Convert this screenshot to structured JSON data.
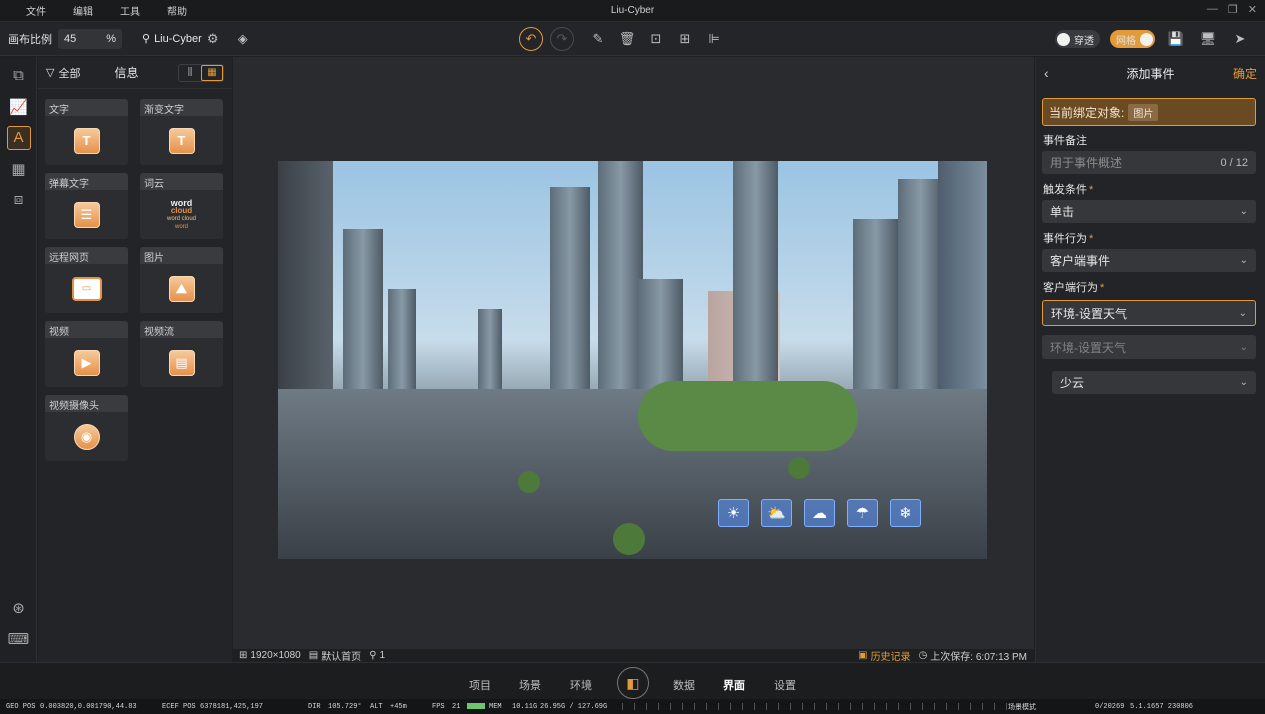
{
  "app": {
    "title": "Liu-Cyber"
  },
  "menu": [
    "文件",
    "编辑",
    "工具",
    "帮助"
  ],
  "window_controls": [
    "—",
    "❐",
    "✕"
  ],
  "toolbar": {
    "canvas_ratio_label": "画布比例",
    "canvas_ratio_value": "45",
    "canvas_ratio_unit": "%",
    "project_name": "Liu-Cyber",
    "toggle_penetrate": "穿透",
    "toggle_snap": "网格"
  },
  "left_panel": {
    "filter_label": "全部",
    "title": "信息",
    "components": [
      {
        "label": "文字",
        "icon": "text-icon"
      },
      {
        "label": "渐变文字",
        "icon": "gradient-text-icon"
      },
      {
        "label": "弹幕文字",
        "icon": "barrage-text-icon"
      },
      {
        "label": "词云",
        "icon": "word-cloud-icon"
      },
      {
        "label": "远程网页",
        "icon": "webpage-icon"
      },
      {
        "label": "图片",
        "icon": "image-icon"
      },
      {
        "label": "视频",
        "icon": "video-icon"
      },
      {
        "label": "视频流",
        "icon": "video-stream-icon"
      },
      {
        "label": "视频摄像头",
        "icon": "camera-icon"
      }
    ],
    "wordcloud_text": [
      "word",
      "cloud",
      "word cloud",
      "word"
    ]
  },
  "canvas_status": {
    "resolution": "1920×1080",
    "default_page": "默认首页",
    "pin_count": "1",
    "history": "历史记录",
    "last_saved": "上次保存: 6:07:13 PM"
  },
  "right_panel": {
    "title": "添加事件",
    "confirm": "确定",
    "bound_object_label": "当前绑定对象:",
    "bound_object_value": "图片",
    "event_note_label": "事件备注",
    "event_note_placeholder": "用于事件概述",
    "event_note_count": "0 / 12",
    "trigger_label": "触发条件",
    "trigger_value": "单击",
    "action_label": "事件行为",
    "action_value": "客户端事件",
    "client_action_label": "客户端行为",
    "client_action_value": "环境-设置天气",
    "dropdown_option": "环境-设置天气",
    "weather_value": "少云"
  },
  "bottom_nav": [
    "项目",
    "场景",
    "环境",
    "数据",
    "界面",
    "设置"
  ],
  "bottom_nav_active": "界面",
  "geo_bar": {
    "geo_pos_label": "GEO POS",
    "geo_pos": "0.003820,0.001790,44.83",
    "ecef_label": "ECEF POS",
    "ecef": "6378181,425,197",
    "dir_label": "DIR",
    "dir": "105.729°",
    "alt_label": "ALT",
    "alt": "+45m",
    "fps_label": "FPS",
    "fps": "21",
    "mem_label": "MEM",
    "mem": "10.11G",
    "gpu_mem": "26.95G / 127.69G",
    "scene_mode": "场景模式",
    "frames": "0/20269",
    "version": "5.1.1657 230806"
  },
  "colors": {
    "accent": "#e39b3a",
    "background": "#1e1f21"
  }
}
